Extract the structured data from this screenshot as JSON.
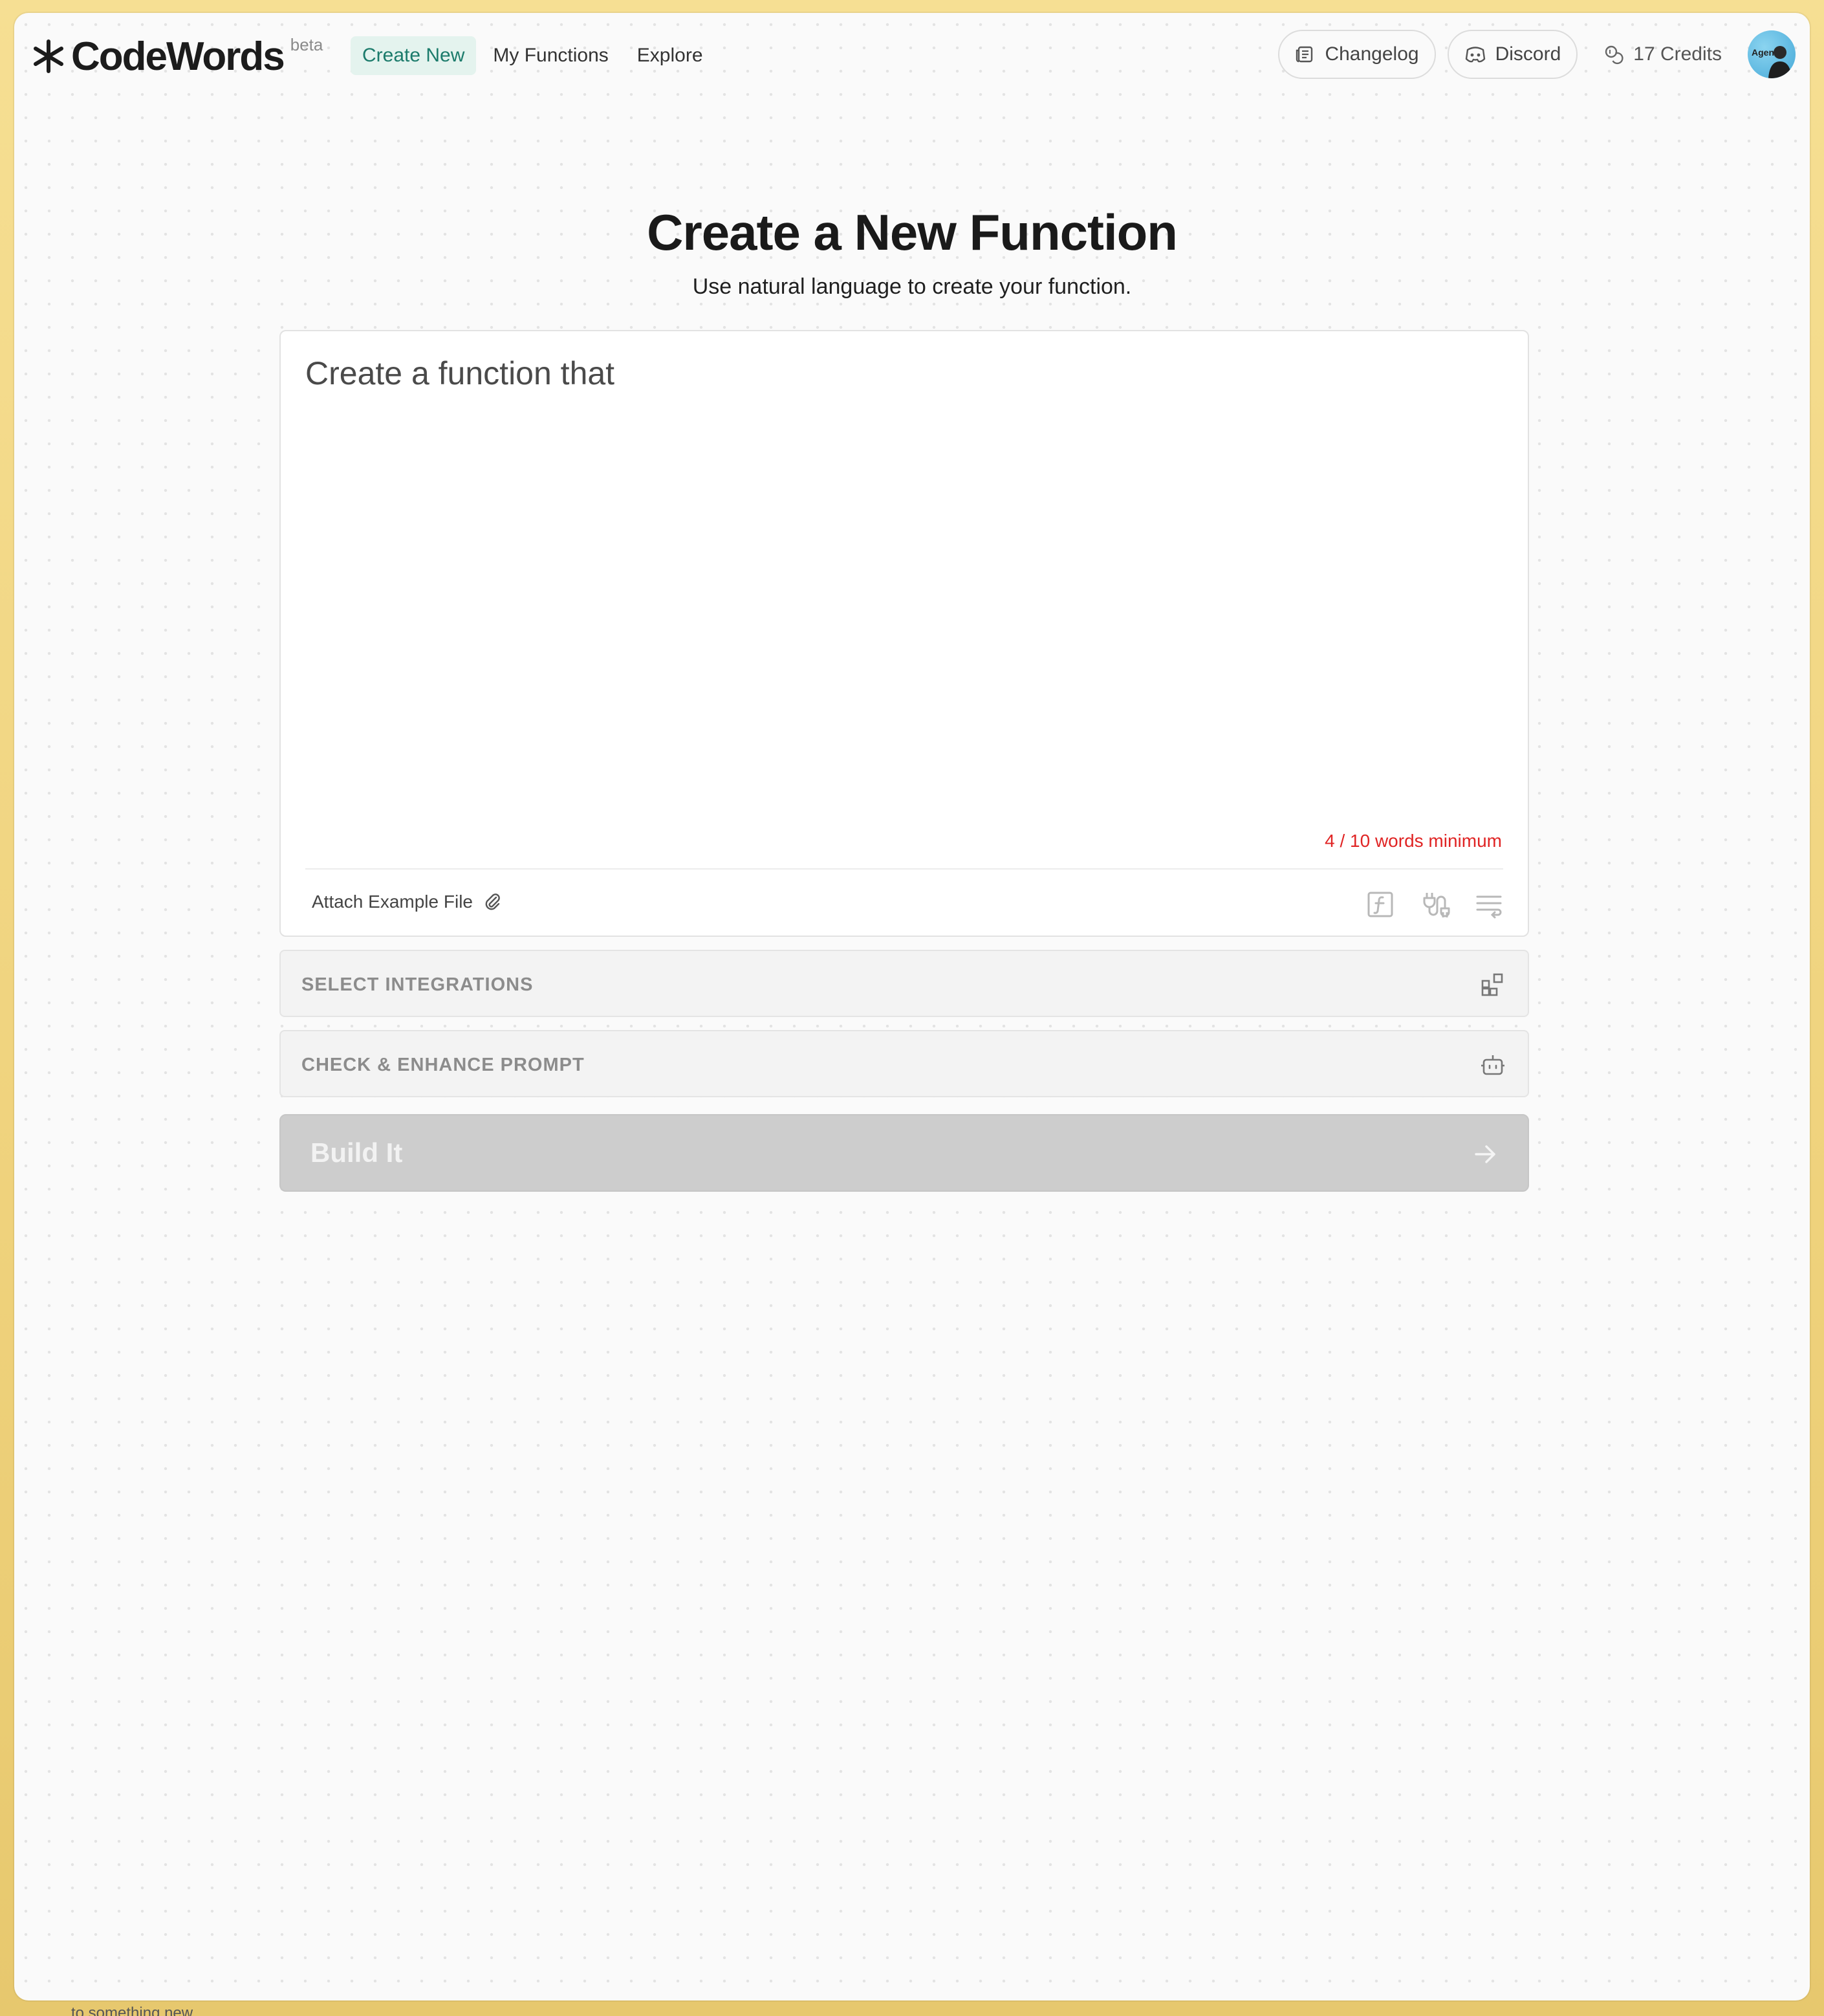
{
  "app": {
    "name": "CodeWords",
    "badge": "beta"
  },
  "nav": {
    "links": [
      {
        "label": "Create New",
        "active": true
      },
      {
        "label": "My Functions",
        "active": false
      },
      {
        "label": "Explore",
        "active": false
      }
    ],
    "changelog_label": "Changelog",
    "discord_label": "Discord",
    "credits_label": "17 Credits",
    "avatar_text": "Agent0"
  },
  "hero": {
    "title": "Create a New Function",
    "subtitle": "Use natural language to create your function."
  },
  "editor": {
    "placeholder": "Create a function that",
    "word_count": "4 / 10 words minimum",
    "attach_label": "Attach Example File",
    "tools": [
      "function-icon",
      "plug-icon",
      "filter-icon"
    ]
  },
  "sections": {
    "integrations_label": "SELECT INTEGRATIONS",
    "enhance_label": "CHECK & ENHANCE PROMPT"
  },
  "build": {
    "label": "Build It"
  },
  "footer_peek": "to something new.",
  "colors": {
    "accent": "#1b7b6b",
    "active_bg": "#e4f3ee",
    "warning": "#e02424",
    "disabled": "#cdcdcd"
  }
}
